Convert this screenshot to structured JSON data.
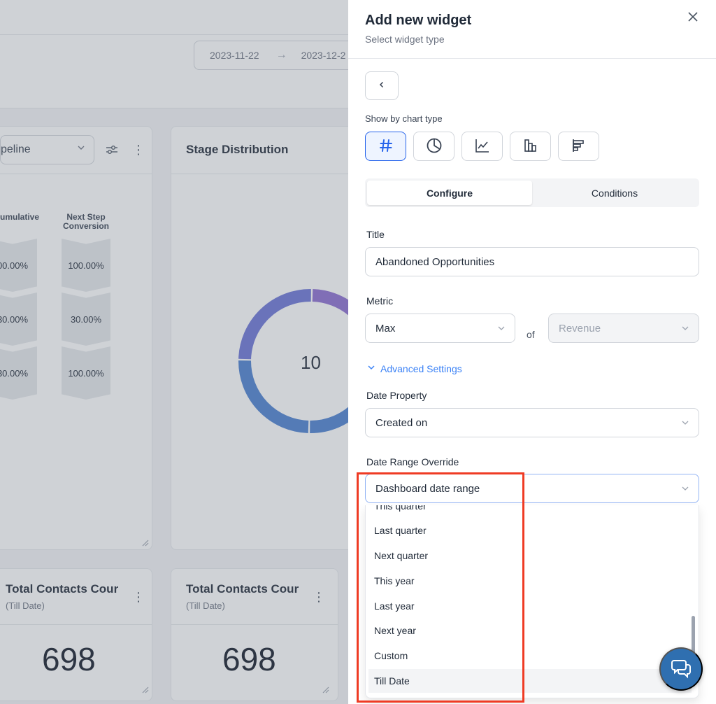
{
  "dashboard": {
    "date_start": "2023-11-22",
    "date_arrow": "→",
    "date_end": "2023-12-2",
    "pipeline_select": "peline",
    "funnel": {
      "col_cumulative": "umulative",
      "col_next_line1": "Next Step",
      "col_next_line2": "Conversion",
      "cumulative_values": [
        "00.00%",
        "30.00%",
        "30.00%"
      ],
      "next_values": [
        "100.00%",
        "30.00%",
        "100.00%"
      ]
    },
    "stage_title": "Stage Distribution",
    "donut_center": "10",
    "donut": {
      "segments": [
        {
          "color": "#8b6cd0",
          "fraction": 0.22
        },
        {
          "color": "#4a7fd0",
          "fraction": 0.28
        },
        {
          "color": "#4a7fd0",
          "fraction": 0.25
        },
        {
          "color": "#6a74d6",
          "fraction": 0.25
        }
      ]
    },
    "total_cards": [
      {
        "title": "Total Contacts Cour",
        "subtitle": "(Till Date)",
        "value": "698"
      },
      {
        "title": "Total Contacts Cour",
        "subtitle": "(Till Date)",
        "value": "698"
      }
    ]
  },
  "drawer": {
    "title": "Add new widget",
    "subtitle": "Select widget type",
    "close_icon": "close-icon",
    "back_icon": "chevron-left-icon",
    "chart_type_label": "Show by chart type",
    "chart_types": [
      {
        "icon": "hash-icon",
        "active": true
      },
      {
        "icon": "pie-chart-icon",
        "active": false
      },
      {
        "icon": "line-chart-icon",
        "active": false
      },
      {
        "icon": "bar-chart-icon",
        "active": false
      },
      {
        "icon": "horizontal-bar-chart-icon",
        "active": false
      }
    ],
    "tabs": {
      "configure": "Configure",
      "conditions": "Conditions"
    },
    "title_label": "Title",
    "title_value": "Abandoned Opportunities",
    "metric_label": "Metric",
    "metric_value": "Max",
    "of_text": "of",
    "metric_field_placeholder": "Revenue",
    "advanced_settings": "Advanced Settings",
    "date_property_label": "Date Property",
    "date_property_value": "Created on",
    "date_range_override_label": "Date Range Override",
    "date_range_override_value": "Dashboard date range",
    "date_range_options": [
      "This quarter",
      "Last quarter",
      "Next quarter",
      "This year",
      "Last year",
      "Next year",
      "Custom",
      "Till Date"
    ],
    "highlighted_option": "Till Date"
  },
  "colors": {
    "accent": "#3b82f6",
    "annotation": "#ef3b24",
    "chat_button": "#2f6fb0"
  },
  "chat_icon": "chat-bubbles-icon"
}
